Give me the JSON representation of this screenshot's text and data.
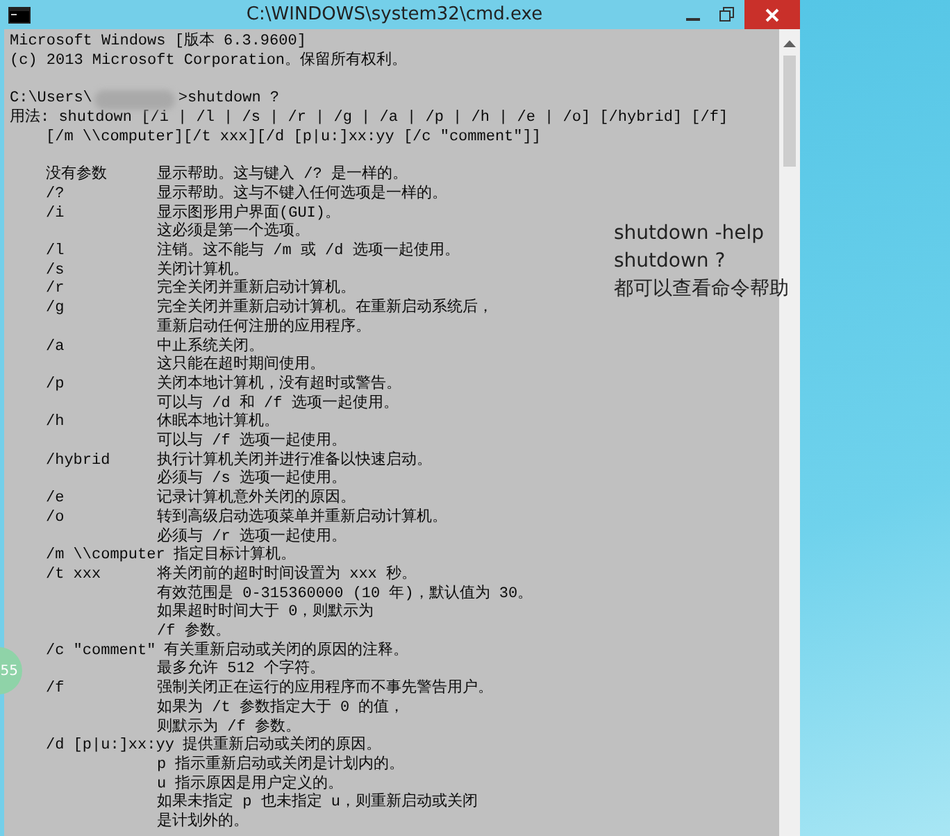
{
  "window": {
    "title": "C:\\WINDOWS\\system32\\cmd.exe"
  },
  "console": {
    "header_lines": [
      "Microsoft Windows [版本 6.3.9600]",
      "(c) 2013 Microsoft Corporation。保留所有权利。"
    ],
    "prompt": {
      "before": "C:\\Users\\",
      "after": ">shutdown ?"
    },
    "usage": {
      "line": "用法: shutdown [/i | /l | /s | /r | /g | /a | /p | /h | /e | /o] [/hybrid] [/f]",
      "continuation": "[/m \\\\computer][/t xxx][/d [p|u:]xx:yy [/c \"comment\"]]"
    },
    "help_rows": [
      {
        "option": "没有参数",
        "description": "显示帮助。这与键入 /? 是一样的。"
      },
      {
        "option": "/?",
        "description": "显示帮助。这与不键入任何选项是一样的。"
      },
      {
        "option": "/i",
        "description": "显示图形用户界面(GUI)。"
      },
      {
        "description": "这必须是第一个选项。"
      },
      {
        "option": "/l",
        "description": "注销。这不能与 /m 或 /d 选项一起使用。"
      },
      {
        "option": "/s",
        "description": "关闭计算机。"
      },
      {
        "option": "/r",
        "description": "完全关闭并重新启动计算机。"
      },
      {
        "option": "/g",
        "description": "完全关闭并重新启动计算机。在重新启动系统后，"
      },
      {
        "description": "重新启动任何注册的应用程序。"
      },
      {
        "option": "/a",
        "description": "中止系统关闭。"
      },
      {
        "description": "这只能在超时期间使用。"
      },
      {
        "option": "/p",
        "description": "关闭本地计算机，没有超时或警告。"
      },
      {
        "description": "可以与 /d 和 /f 选项一起使用。"
      },
      {
        "option": "/h",
        "description": "休眠本地计算机。"
      },
      {
        "description": "可以与 /f 选项一起使用。"
      },
      {
        "option": "/hybrid",
        "description": "执行计算机关闭并进行准备以快速启动。"
      },
      {
        "description": "必须与 /s 选项一起使用。"
      },
      {
        "option": "/e",
        "description": "记录计算机意外关闭的原因。"
      },
      {
        "option": "/o",
        "description": "转到高级启动选项菜单并重新启动计算机。"
      },
      {
        "description": "必须与 /r 选项一起使用。"
      },
      {
        "option": "/m \\\\computer",
        "description": "指定目标计算机。"
      },
      {
        "option": "/t xxx",
        "description": "将关闭前的超时时间设置为 xxx 秒。"
      },
      {
        "description": "有效范围是 0-315360000 (10 年)，默认值为 30。"
      },
      {
        "description": "如果超时时间大于 0，则默示为"
      },
      {
        "description": "/f 参数。"
      },
      {
        "option": "/c \"comment\"",
        "description": "有关重新启动或关闭的原因的注释。"
      },
      {
        "description": "最多允许 512 个字符。"
      },
      {
        "option": "/f",
        "description": "强制关闭正在运行的应用程序而不事先警告用户。"
      },
      {
        "description": "如果为 /t 参数指定大于 0 的值，"
      },
      {
        "description": "则默示为 /f 参数。"
      },
      {
        "option": "/d [p|u:]xx:yy",
        "description": "提供重新启动或关闭的原因。"
      },
      {
        "description": "p 指示重新启动或关闭是计划内的。"
      },
      {
        "description": "u 指示原因是用户定义的。"
      },
      {
        "description": "如果未指定 p 也未指定 u，则重新启动或关闭"
      },
      {
        "description": "是计划外的。"
      }
    ]
  },
  "annotation": {
    "lines": [
      "shutdown -help",
      "shutdown ?",
      "都可以查看命令帮助"
    ]
  },
  "floating_widget": {
    "text": "55"
  }
}
